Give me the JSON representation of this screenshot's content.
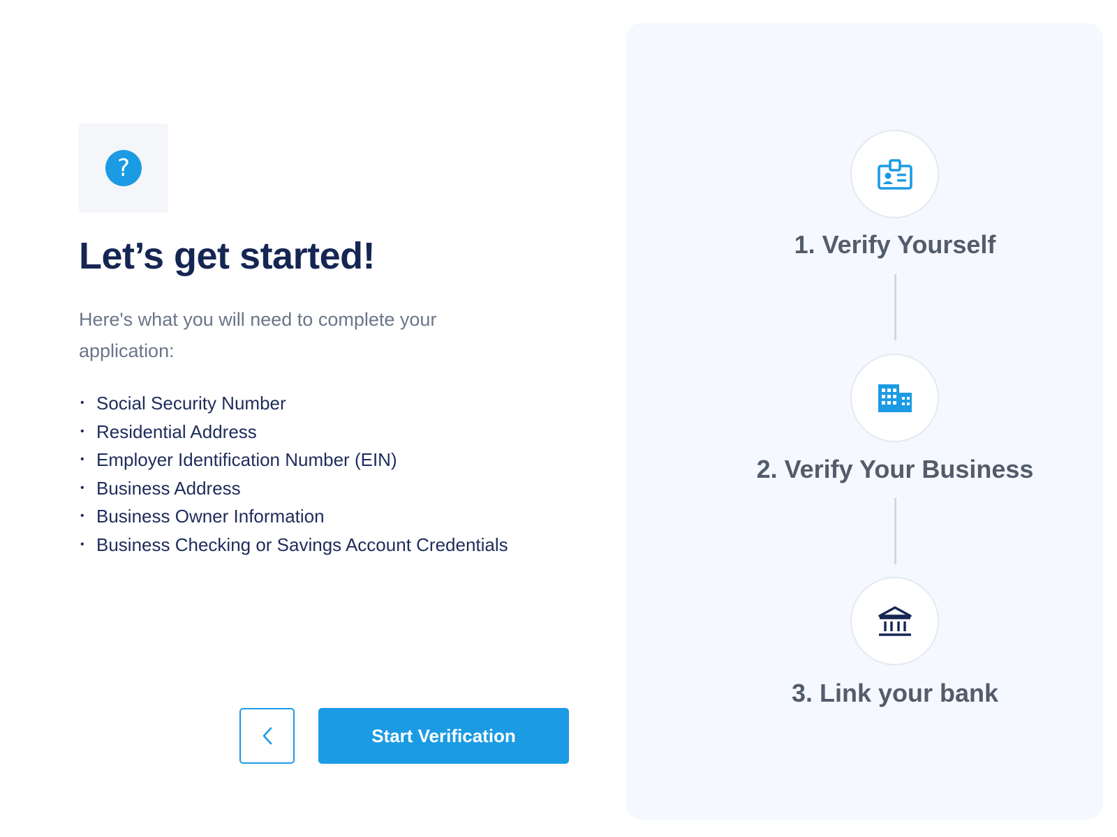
{
  "colors": {
    "accent": "#1b9be3",
    "heading": "#162653",
    "body_text": "#1e2c5a",
    "muted_text": "#6b7588",
    "panel_bg": "#f5f8fe",
    "step_text": "#525c6b"
  },
  "left": {
    "help_icon": "question-circle-icon",
    "help_glyph": "?",
    "title": "Let’s get started!",
    "subtitle": "Here's what you will need to complete your application:",
    "bullet_glyph": "•",
    "requirements": [
      "Social Security Number",
      "Residential Address",
      "Employer Identification Number (EIN)",
      "Business Address",
      "Business Owner Information",
      "Business Checking or Savings Account Credentials"
    ]
  },
  "actions": {
    "back_icon": "chevron-left-icon",
    "start_label": "Start Verification"
  },
  "steps": [
    {
      "label": "1. Verify Yourself",
      "icon": "id-badge-icon"
    },
    {
      "label": "2. Verify Your Business",
      "icon": "office-building-icon"
    },
    {
      "label": "3. Link your bank",
      "icon": "bank-icon"
    }
  ]
}
